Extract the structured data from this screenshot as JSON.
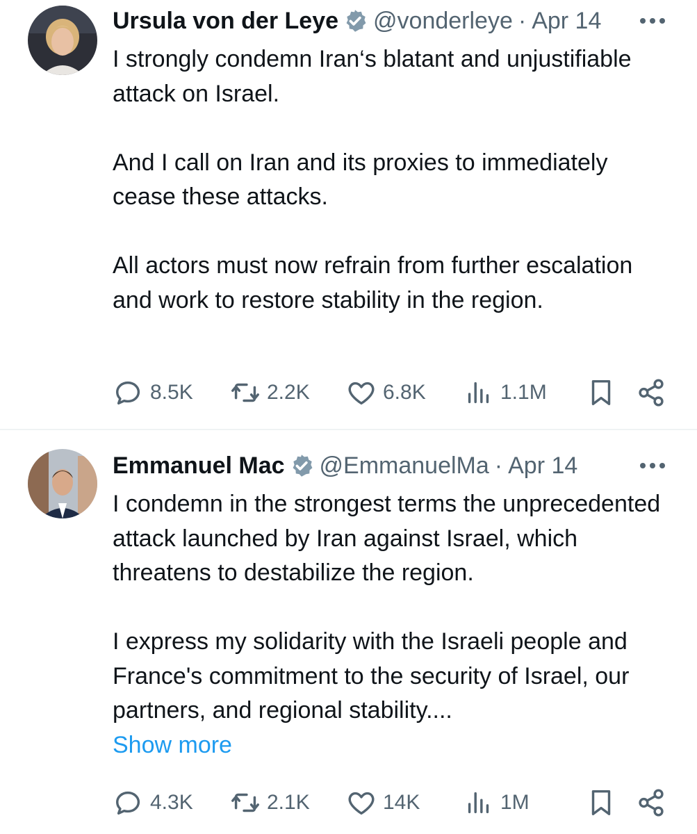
{
  "tweets": [
    {
      "name": "Ursula von der Leye",
      "handle": "@vonderleye",
      "separator": "·",
      "date": "Apr 14",
      "paragraphs": [
        "I strongly condemn Iran‘s blatant and unjustifiable attack on Israel.",
        "And I call on Iran and its proxies to immediately cease these attacks.",
        "All actors must now refrain from further escalation and work to restore stability in the region."
      ],
      "stats": {
        "replies": "8.5K",
        "retweets": "2.2K",
        "likes": "6.8K",
        "views": "1.1M"
      },
      "icons": [
        "verified-badge-icon",
        "more-options-icon",
        "reply-icon",
        "retweet-icon",
        "like-icon",
        "views-icon",
        "bookmark-icon",
        "share-icon"
      ]
    },
    {
      "name": "Emmanuel Mac",
      "handle": "@EmmanuelMa",
      "separator": "·",
      "date": "Apr 14",
      "paragraphs": [
        "I condemn in the strongest terms the unprecedented attack launched by Iran against Israel, which threatens to destabilize the region.",
        "I express my solidarity with the Israeli people and France's commitment to the security of Israel, our partners, and regional stability...."
      ],
      "show_more": "Show more",
      "stats": {
        "replies": "4.3K",
        "retweets": "2.1K",
        "likes": "14K",
        "views": "1M"
      },
      "icons": [
        "verified-badge-icon",
        "more-options-icon",
        "reply-icon",
        "retweet-icon",
        "like-icon",
        "views-icon",
        "bookmark-icon",
        "share-icon"
      ]
    }
  ],
  "colors": {
    "text": "#0f1419",
    "secondary": "#536471",
    "link": "#1d9bf0",
    "verified": "#829aab",
    "divider": "#eff3f4"
  }
}
